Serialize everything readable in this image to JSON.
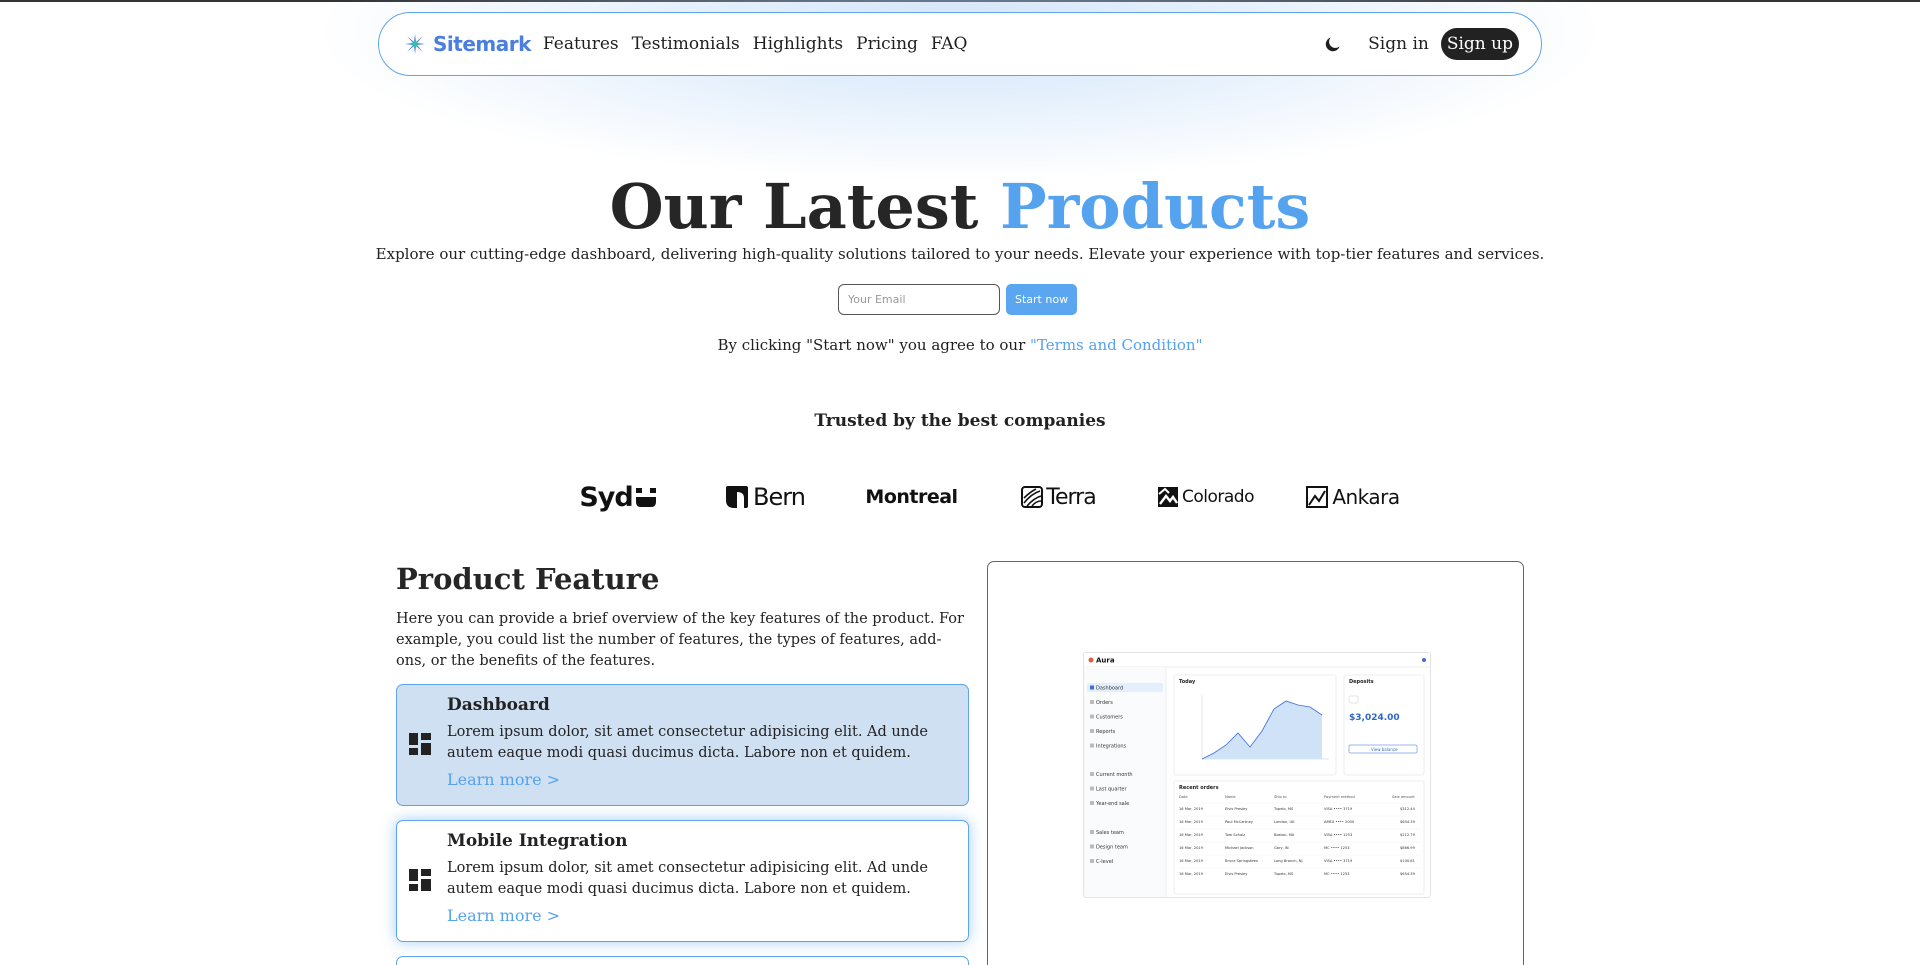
{
  "nav": {
    "brand": "Sitemark",
    "links": [
      "Features",
      "Testimonials",
      "Highlights",
      "Pricing",
      "FAQ"
    ],
    "signin": "Sign in",
    "signup": "Sign up"
  },
  "hero": {
    "title_main": "Our Latest",
    "title_accent": "Products",
    "subtitle": "Explore our cutting-edge dashboard, delivering high-quality solutions tailored to your needs. Elevate your experience with top-tier features and services.",
    "email_placeholder": "Your Email",
    "start_button": "Start now",
    "terms_prefix": "By clicking \"Start now\" you agree to our",
    "terms_link": "\"Terms and Condition\""
  },
  "trusted": {
    "heading": "Trusted by the best companies",
    "companies": [
      "Syd",
      "Bern",
      "Montreal",
      "Terra",
      "Colorado",
      "Ankara"
    ]
  },
  "features": {
    "title": "Product Feature",
    "description": "Here you can provide a brief overview of the key features of the product. For example, you could list the number of features, the types of features, add-ons, or the benefits of the features.",
    "items": [
      {
        "title": "Dashboard",
        "text": "Lorem ipsum dolor, sit amet consectetur adipisicing elit. Ad unde autem eaque modi quasi ducimus dicta. Labore non et quidem.",
        "link": "Learn more >"
      },
      {
        "title": "Mobile Integration",
        "text": "Lorem ipsum dolor, sit amet consectetur adipisicing elit. Ad unde autem eaque modi quasi ducimus dicta. Labore non et quidem.",
        "link": "Learn more >"
      }
    ]
  },
  "preview": {
    "app": "Aura",
    "side_items": [
      "Dashboard",
      "Orders",
      "Customers",
      "Reports",
      "Integrations"
    ],
    "saved_reports": [
      "Current month",
      "Last quarter",
      "Year-end sale"
    ],
    "teams": [
      "Sales team",
      "Design team",
      "C-level"
    ],
    "today": "Today",
    "deposits": "Deposits",
    "deposit_amount": "$3,024.00",
    "view_balance": "View balance",
    "recent_orders": "Recent orders",
    "order_headers": [
      "Date",
      "Name",
      "Ship to",
      "Payment method",
      "Sale amount"
    ],
    "orders": [
      [
        "16 Mar, 2019",
        "Elvis Presley",
        "Tupelo, MS",
        "VISA •••• 3719",
        "$312.44"
      ],
      [
        "16 Mar, 2019",
        "Paul McCartney",
        "London, UK",
        "AMEX •••• 2000",
        "$654.39"
      ],
      [
        "16 Mar, 2019",
        "Tom Scholz",
        "Boston, MA",
        "VISA •••• 1253",
        "$212.79"
      ],
      [
        "16 Mar, 2019",
        "Michael Jackson",
        "Gary, IN",
        "MC •••• 1253",
        "$866.99"
      ],
      [
        "16 Mar, 2019",
        "Bruce Springsteen",
        "Long Branch, NJ",
        "VISA •••• 3719",
        "$100.81"
      ],
      [
        "16 Mar, 2019",
        "Elvis Presley",
        "Tupelo, MS",
        "MC •••• 1253",
        "$654.39"
      ]
    ]
  },
  "colors": {
    "accent": "#55a2ef",
    "border": "#5ea5ea",
    "active_card": "#cfe0f2"
  }
}
